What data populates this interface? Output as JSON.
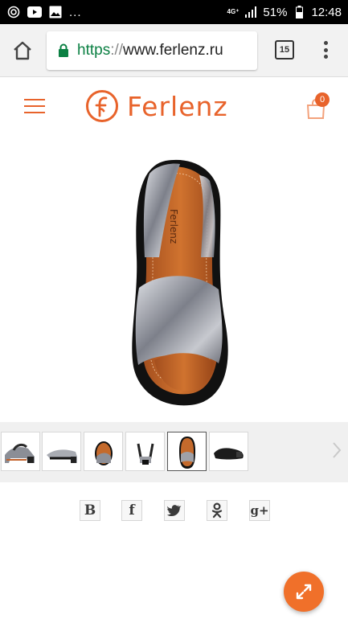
{
  "status_bar": {
    "network": "4G⁺",
    "battery": "51%",
    "time": "12:48",
    "more": "..."
  },
  "browser": {
    "url_scheme": "https",
    "url_sep": "://",
    "url_host": "www.ferlenz.ru",
    "tab_count": "15"
  },
  "site": {
    "logo_text": "Ferlenz",
    "cart_count": "0",
    "accent_color": "#e8632b"
  },
  "product": {
    "image_brand_text": "Ferlenz"
  },
  "thumbnails": {
    "count": 6,
    "active_index": 4
  },
  "social": {
    "items": [
      {
        "icon": "vk-icon",
        "label": "B"
      },
      {
        "icon": "facebook-icon",
        "label": "f"
      },
      {
        "icon": "twitter-icon",
        "label": ""
      },
      {
        "icon": "odnoklassniki-icon",
        "label": ""
      },
      {
        "icon": "google-plus-icon",
        "label": "g+"
      }
    ]
  },
  "fab": {
    "icon": "expand-icon"
  }
}
